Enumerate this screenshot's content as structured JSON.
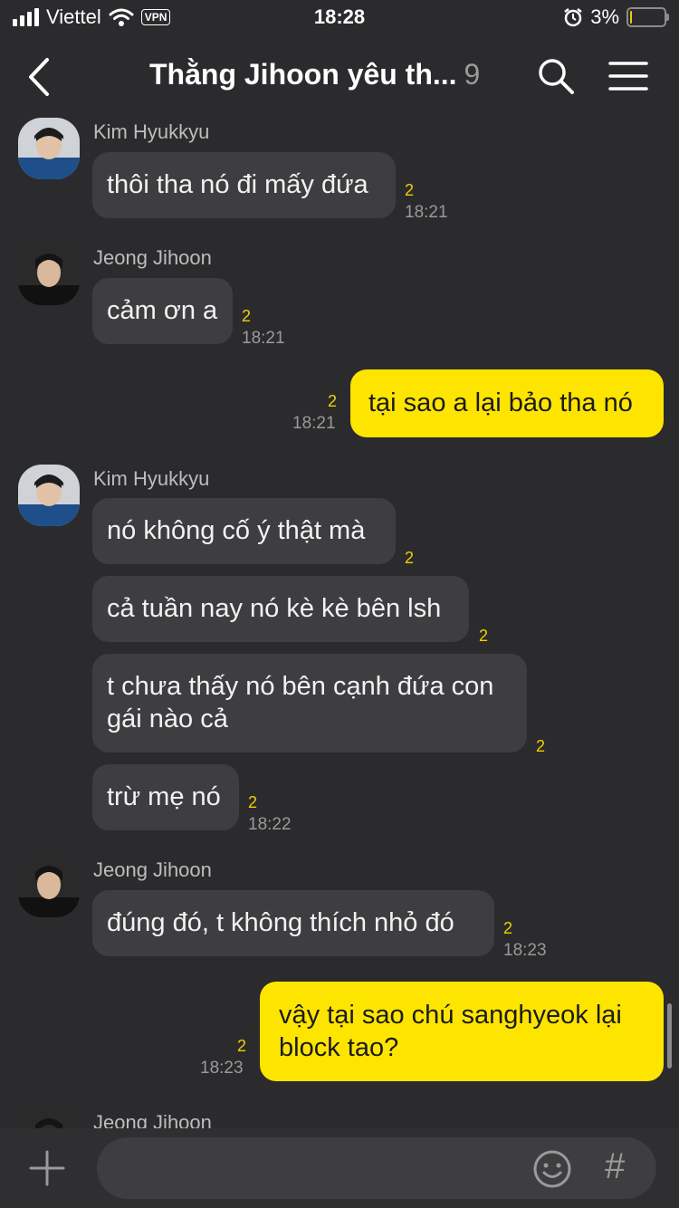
{
  "status_bar": {
    "carrier": "Viettel",
    "vpn": "VPN",
    "time": "18:28",
    "battery_percent": "3%",
    "battery_level": 0.03
  },
  "header": {
    "title": "Thằng Jihoon yêu th...",
    "member_count": "9"
  },
  "messages": [
    {
      "sender": "Kim Hyukkyu",
      "text": "thôi tha nó đi mấy đứa",
      "unread": "2",
      "time": "18:21"
    },
    {
      "sender": "Jeong Jihoon",
      "text": "cảm ơn a",
      "unread": "2",
      "time": "18:21"
    },
    {
      "sender": "me",
      "text": "tại sao a lại bảo tha nó",
      "unread": "2",
      "time": "18:21"
    },
    {
      "sender": "Kim Hyukkyu",
      "text": "nó không cố ý thật mà",
      "unread": "2"
    },
    {
      "text": "cả tuần nay nó kè kè bên lsh",
      "unread": "2"
    },
    {
      "text_line1": "t chưa thấy nó bên cạnh đứa con",
      "text_line2": "gái nào cả",
      "unread": "2"
    },
    {
      "text": "trừ mẹ nó",
      "unread": "2",
      "time": "18:22"
    },
    {
      "sender": "Jeong Jihoon",
      "text": "đúng đó, t không thích nhỏ đó",
      "unread": "2",
      "time": "18:23"
    },
    {
      "sender": "me",
      "text_line1": "vậy tại sao chú sanghyeok lại",
      "text_line2": "block tao?",
      "unread": "2",
      "time": "18:23"
    },
    {
      "sender": "Jeong Jihoon"
    }
  ],
  "icons": {
    "back": "chevron-left-icon",
    "search": "search-icon",
    "menu": "hamburger-menu-icon",
    "plus": "plus-icon",
    "emoji": "emoji-icon",
    "hash": "#"
  },
  "colors": {
    "background": "#2b2b2d",
    "bubble_other": "#3e3e41",
    "bubble_mine": "#fee500",
    "unread": "#f0d000"
  }
}
